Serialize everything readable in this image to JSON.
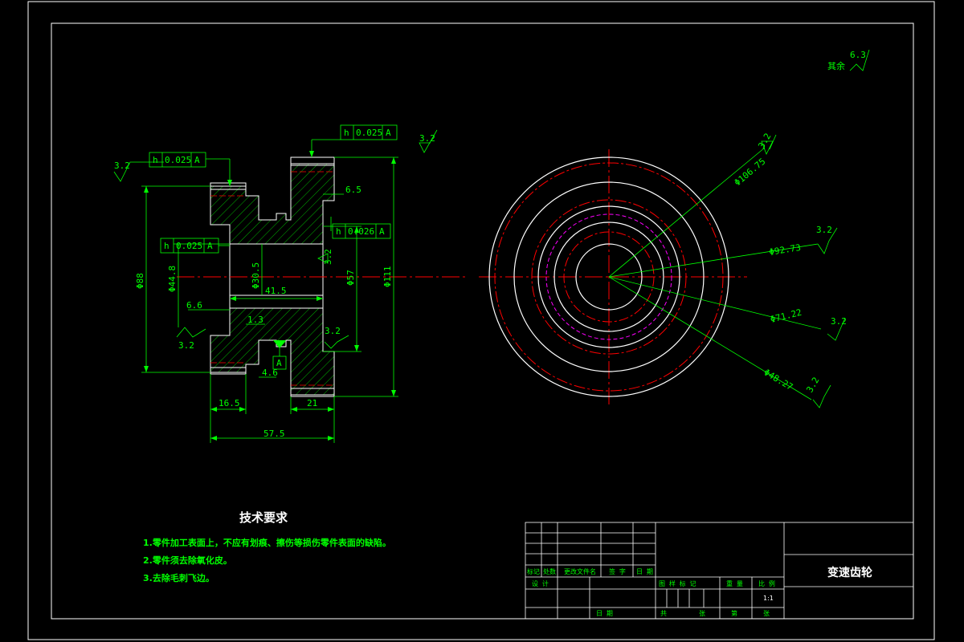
{
  "colors": {
    "background": "#000000",
    "outline": "#ffffff",
    "dimension": "#00ff00",
    "centerline": "#ff0000",
    "pitch_circle": "#ff00ff",
    "hatch": "#00ff00"
  },
  "roughness": {
    "other": "6.3",
    "other_label": "其余",
    "s1": "3.2",
    "s2": "3.2",
    "s3": "3.2",
    "s4": "3.2",
    "s5": "3.2",
    "s6": "3.2",
    "r1": "3.2",
    "r2": "3.2",
    "r3": "3.2",
    "r4": "3.2"
  },
  "tolerances": {
    "top": {
      "symbol": "h",
      "value": "0.025",
      "datum": "A"
    },
    "left": {
      "symbol": "h",
      "value": "0.025",
      "datum": "A"
    },
    "mid": {
      "symbol": "h",
      "value": "0.025",
      "datum": "A"
    },
    "right": {
      "symbol": "h",
      "value": "0.026",
      "datum": "A"
    }
  },
  "datum_label": "A",
  "dimensions": {
    "d88": "Φ88",
    "d44": "Φ44.8",
    "d30": "Φ30.5",
    "d57": "Φ57",
    "d111": "Φ111",
    "l41": "41.5",
    "l6_5": "6.5",
    "l6_6": "6.6",
    "l1_3": "1.3",
    "l4_6": "4.6",
    "l16_5": "16.5",
    "l21": "21",
    "l57_5": "57.5"
  },
  "circle_dims": {
    "c1": "Φ106.75",
    "c2": "Φ92.73",
    "c3": "Φ71.22",
    "c4": "Φ48.27"
  },
  "tech": {
    "title": "技术要求",
    "items": [
      "1.零件加工表面上，不应有划痕、擦伤等损伤零件表面的缺陷。",
      "2.零件须去除氧化皮。",
      "3.去除毛刺飞边。"
    ]
  },
  "title_block": {
    "part_name": "变速齿轮",
    "scale": "1:1",
    "h1": "标记",
    "h2": "处数",
    "h3": "更改文件名",
    "h4": "签 字",
    "h5": "日 期",
    "design": "设 计",
    "date": "日 期",
    "cols": [
      "图 样 标 记",
      "重 量",
      "比 例"
    ],
    "bottom": [
      "共",
      "张",
      "第",
      "张"
    ]
  }
}
